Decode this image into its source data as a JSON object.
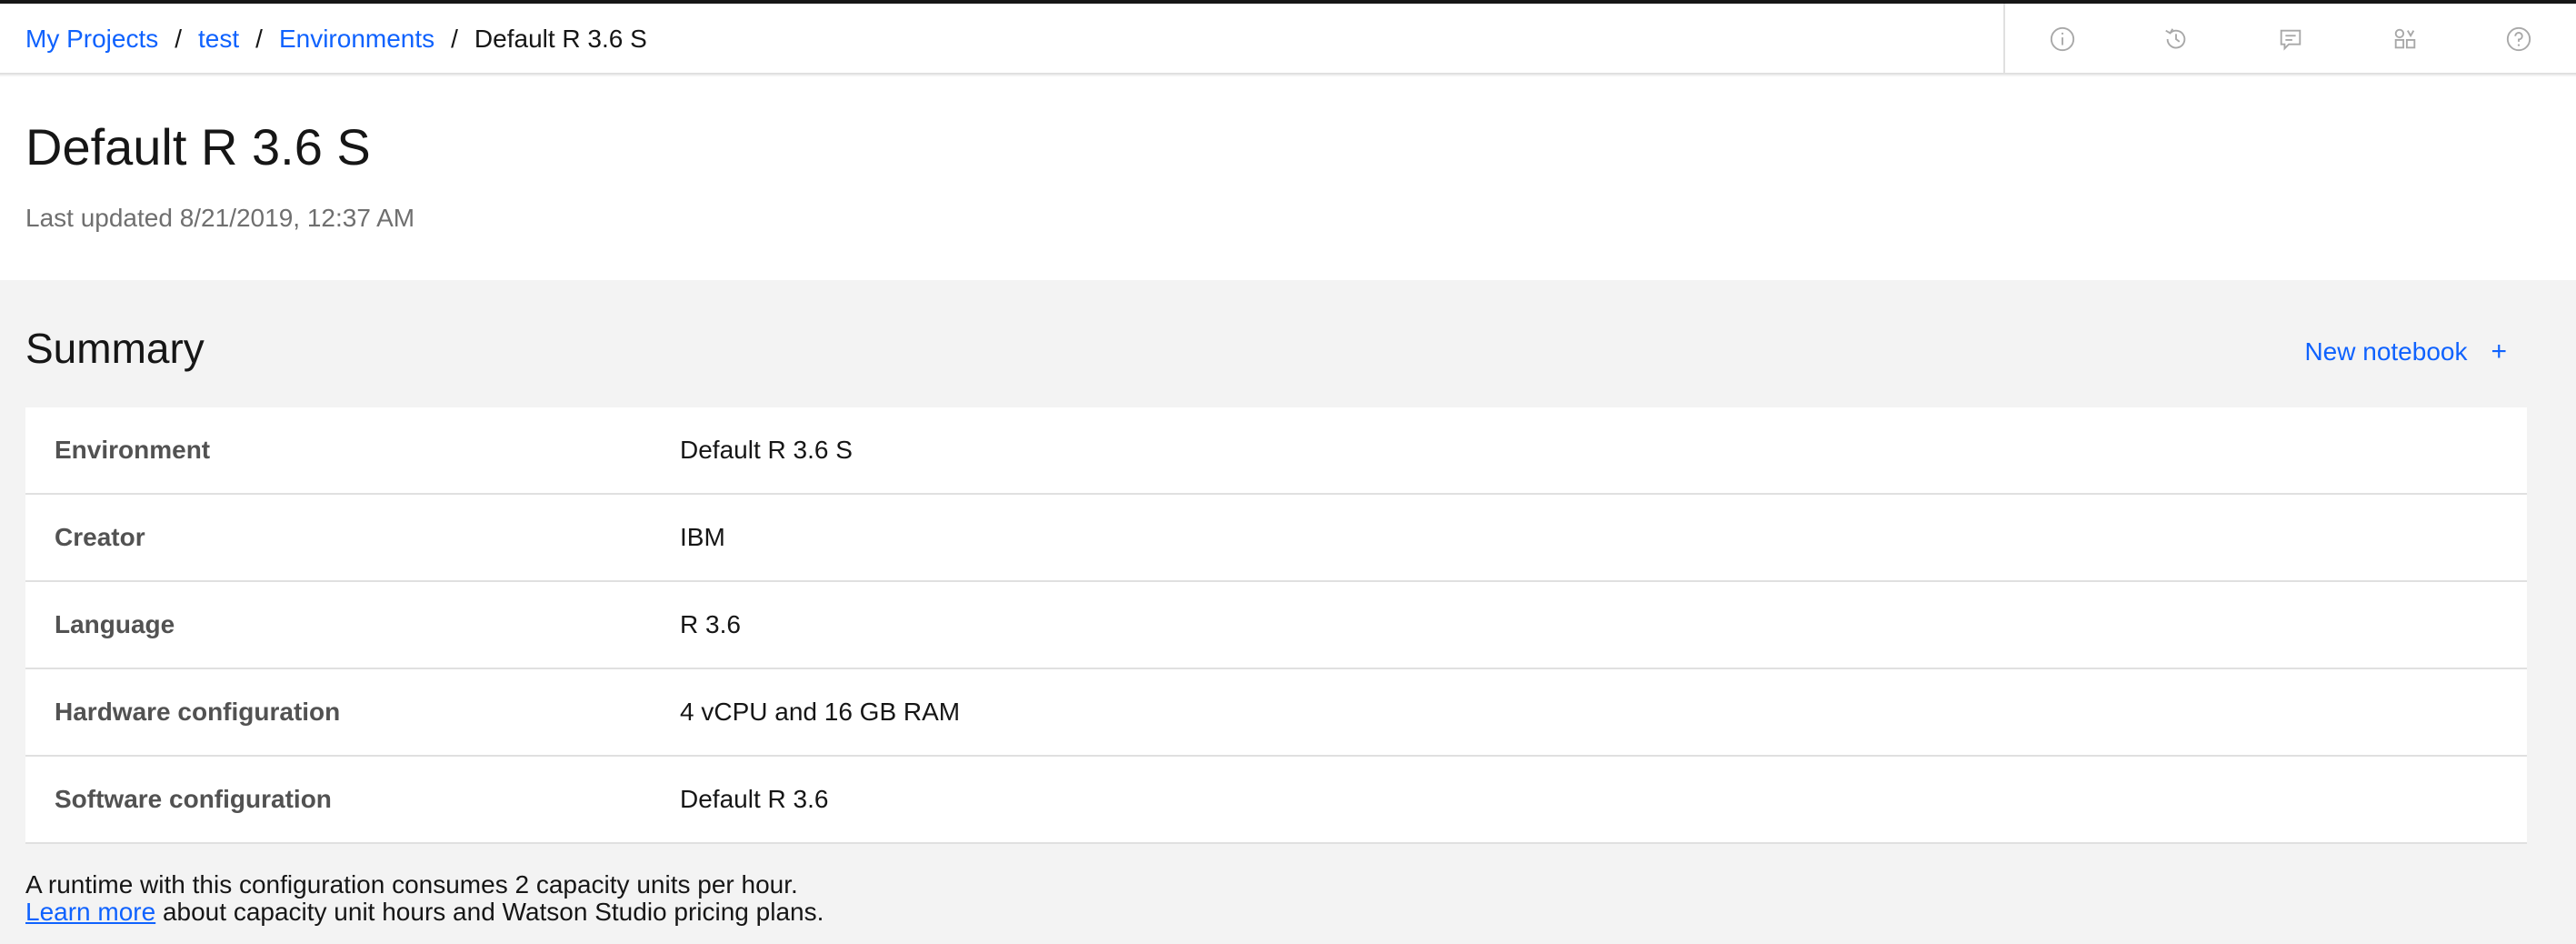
{
  "breadcrumb": {
    "items": [
      "My Projects",
      "test",
      "Environments"
    ],
    "separator": "/",
    "current": "Default R 3.6 S"
  },
  "header_icons": [
    "info-icon",
    "history-icon",
    "comment-icon",
    "data-assets-icon",
    "help-icon"
  ],
  "page": {
    "title": "Default R 3.6 S",
    "last_updated": "Last updated 8/21/2019, 12:37 AM"
  },
  "summary": {
    "heading": "Summary",
    "new_notebook_label": "New notebook",
    "new_notebook_icon": "+",
    "rows": [
      {
        "key": "Environment",
        "value": "Default R 3.6 S"
      },
      {
        "key": "Creator",
        "value": "IBM"
      },
      {
        "key": "Language",
        "value": "R 3.6"
      },
      {
        "key": "Hardware configuration",
        "value": "4 vCPU and 16 GB RAM"
      },
      {
        "key": "Software configuration",
        "value": "Default R 3.6"
      }
    ]
  },
  "footer": {
    "line1": "A runtime with this configuration consumes 2 capacity units per hour.",
    "learn_more": "Learn more",
    "line2_rest": " about capacity unit hours and Watson Studio pricing plans."
  },
  "colors": {
    "link": "#0f62fe",
    "icon": "#a8a8a8",
    "background": "#f3f3f3"
  }
}
